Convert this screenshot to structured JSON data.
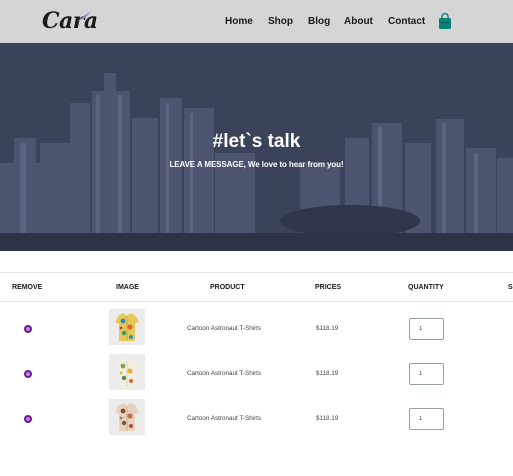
{
  "header": {
    "logo_text": "Cara",
    "nav": [
      "Home",
      "Shop",
      "Blog",
      "About",
      "Contact"
    ],
    "bag_icon": "shopping-bag-icon",
    "accent_color": "#088178"
  },
  "hero": {
    "title": "#let`s talk",
    "subtitle": "LEAVE A MESSAGE, We love to hear from you!"
  },
  "cart": {
    "columns": [
      "REMOVE",
      "IMAGE",
      "PRODUCT",
      "PRICES",
      "QUANTITY",
      "S"
    ],
    "rows": [
      {
        "product": "Cartoon Astronaut T-Shirts",
        "price": "$118.19",
        "quantity": "1"
      },
      {
        "product": "Cartoon Astronaut T-Shirts",
        "price": "$118.19",
        "quantity": "1"
      },
      {
        "product": "Cartoon Astronaut T-Shirts",
        "price": "$118.19",
        "quantity": "1"
      }
    ],
    "remove_icon": "remove-circle-icon",
    "remove_color": "#6a1b9a"
  }
}
